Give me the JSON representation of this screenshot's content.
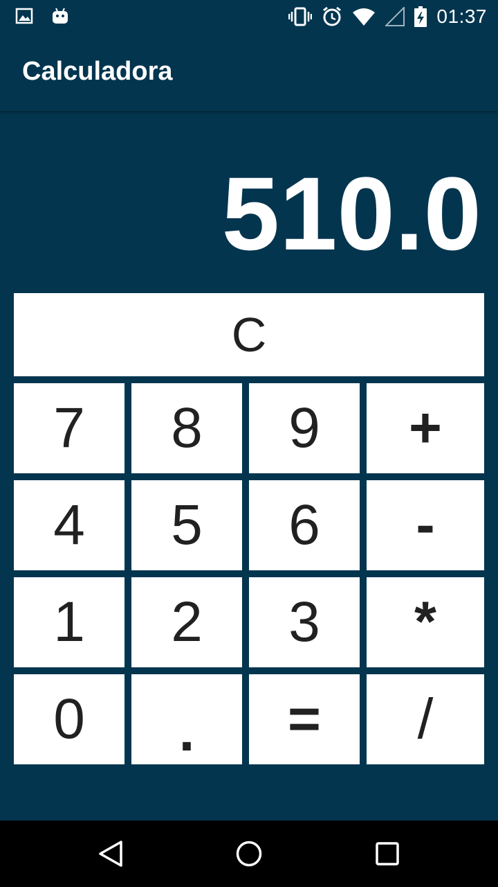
{
  "status_bar": {
    "time": "01:37",
    "left_icons": [
      "image-icon",
      "android-icon"
    ],
    "right_icons": [
      "vibrate-icon",
      "alarm-icon",
      "wifi-icon",
      "signal-icon",
      "battery-charging-icon"
    ]
  },
  "app_bar": {
    "title": "Calculadora"
  },
  "display": {
    "value": "510.0"
  },
  "keypad": {
    "clear_label": "C",
    "row1": [
      "7",
      "8",
      "9",
      "+"
    ],
    "row2": [
      "4",
      "5",
      "6",
      "-"
    ],
    "row3": [
      "1",
      "2",
      "3",
      "*"
    ],
    "row4": [
      "0",
      ".",
      "=",
      "/"
    ]
  },
  "nav_bar": {
    "buttons": [
      "back-icon",
      "home-icon",
      "recents-icon"
    ]
  },
  "colors": {
    "background": "#04354f",
    "key_background": "#ffffff",
    "key_text": "#212121",
    "nav_bar": "#000000"
  }
}
